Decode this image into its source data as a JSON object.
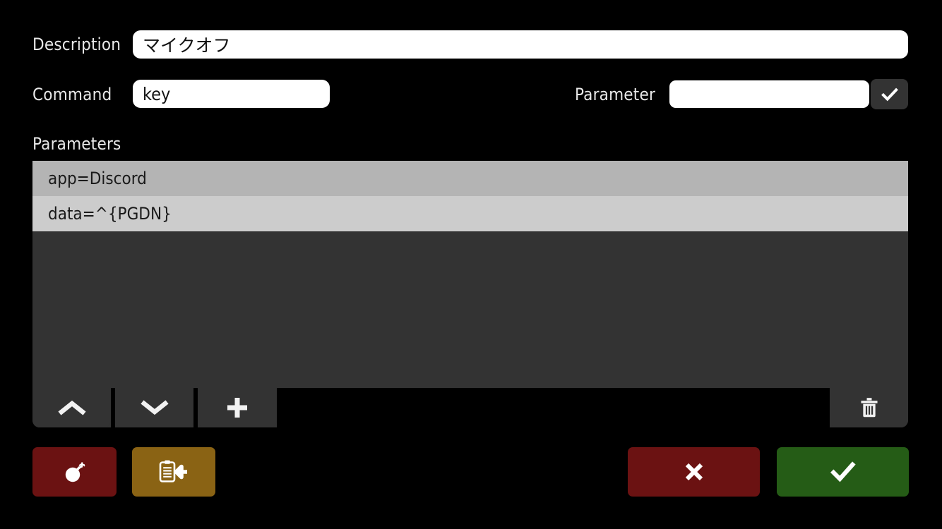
{
  "theme": {
    "background": "#000000",
    "panel": "#333333",
    "input_bg": "#ffffff",
    "row_selected": "#b4b4b4",
    "row_normal": "#cccccc",
    "danger": "#6b1212",
    "warning": "#8a6314",
    "success": "#255c16",
    "text": "#e8e8e8"
  },
  "form": {
    "description": {
      "label": "Description",
      "value": "マイクオフ",
      "placeholder": ""
    },
    "command": {
      "label": "Command",
      "value": "key",
      "placeholder": ""
    },
    "parameter": {
      "label": "Parameter",
      "value": "",
      "placeholder": "",
      "confirm_icon": "check-icon"
    }
  },
  "parameters_section": {
    "label": "Parameters",
    "rows": [
      {
        "text": "app=Discord",
        "selected": true
      },
      {
        "text": "data=^{PGDN}",
        "selected": false
      }
    ],
    "toolbar": [
      {
        "name": "move-up-button",
        "icon": "chevron-up-icon"
      },
      {
        "name": "move-down-button",
        "icon": "chevron-down-icon"
      },
      {
        "name": "add-param-button",
        "icon": "plus-icon"
      },
      {
        "name": "delete-param-button",
        "icon": "trash-icon"
      }
    ]
  },
  "actions": [
    {
      "name": "clear-all-button",
      "icon": "bomb-icon",
      "color": "#6b1212"
    },
    {
      "name": "import-button",
      "icon": "clipboard-import-icon",
      "color": "#8a6314"
    },
    {
      "name": "cancel-button",
      "icon": "close-x-icon",
      "color": "#6b1212"
    },
    {
      "name": "confirm-button",
      "icon": "check-icon",
      "color": "#255c16"
    }
  ]
}
